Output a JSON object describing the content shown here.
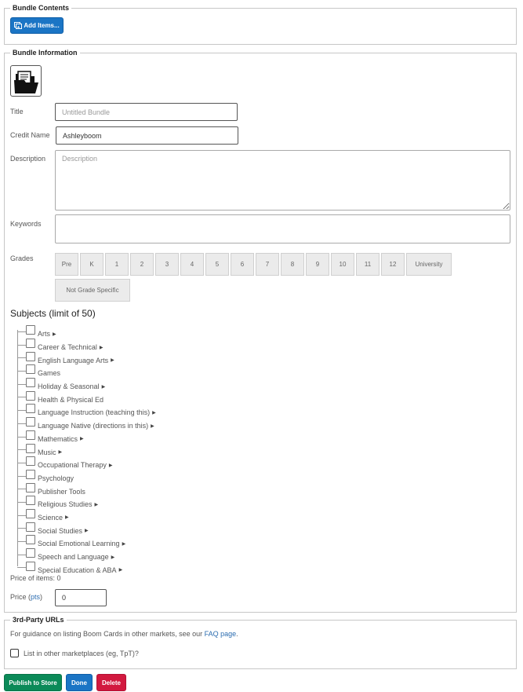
{
  "bundle_contents": {
    "legend": "Bundle Contents",
    "add_items_label": "Add Items..."
  },
  "bundle_info": {
    "legend": "Bundle Information",
    "icon": "folder-icon",
    "title_label": "Title",
    "title_placeholder": "Untitled Bundle",
    "credit_label": "Credit Name",
    "credit_value": "Ashleyboom",
    "description_label": "Description",
    "description_placeholder": "Description",
    "keywords_label": "Keywords",
    "grades_label": "Grades",
    "grades": [
      "Pre",
      "K",
      "1",
      "2",
      "3",
      "4",
      "5",
      "6",
      "7",
      "8",
      "9",
      "10",
      "11",
      "12",
      "University",
      "Not Grade Specific"
    ],
    "subjects_title": "Subjects (limit of 50)",
    "subjects": [
      {
        "label": "Arts",
        "expandable": true
      },
      {
        "label": "Career & Technical",
        "expandable": true
      },
      {
        "label": "English Language Arts",
        "expandable": true
      },
      {
        "label": "Games",
        "expandable": false
      },
      {
        "label": "Holiday & Seasonal",
        "expandable": true
      },
      {
        "label": "Health & Physical Ed",
        "expandable": false
      },
      {
        "label": "Language Instruction (teaching this)",
        "expandable": true
      },
      {
        "label": "Language Native (directions in this)",
        "expandable": true
      },
      {
        "label": "Mathematics",
        "expandable": true
      },
      {
        "label": "Music",
        "expandable": true
      },
      {
        "label": "Occupational Therapy",
        "expandable": true
      },
      {
        "label": "Psychology",
        "expandable": false
      },
      {
        "label": "Publisher Tools",
        "expandable": false
      },
      {
        "label": "Religious Studies",
        "expandable": true
      },
      {
        "label": "Science",
        "expandable": true
      },
      {
        "label": "Social Studies",
        "expandable": true
      },
      {
        "label": "Social Emotional Learning",
        "expandable": true
      },
      {
        "label": "Speech and Language",
        "expandable": true
      },
      {
        "label": "Special Education & ABA",
        "expandable": true
      }
    ],
    "price_of_items": "Price of items: 0",
    "price_label": "Price",
    "price_unit_link": "pts",
    "price_value": "0"
  },
  "third_party": {
    "legend": "3rd-Party URLs",
    "guidance_text": "For guidance on listing Boom Cards in other markets, see our ",
    "faq_link": "FAQ page",
    "guidance_end": ".",
    "list_checkbox_label": "List in other marketplaces (eg, TpT)?"
  },
  "actions": {
    "publish_label": "Publish to Store",
    "done_label": "Done",
    "delete_label": "Delete"
  },
  "colors": {
    "primary": "#1b75c5",
    "success": "#0b8a58",
    "danger": "#d2193f",
    "link": "#2c6db0"
  }
}
